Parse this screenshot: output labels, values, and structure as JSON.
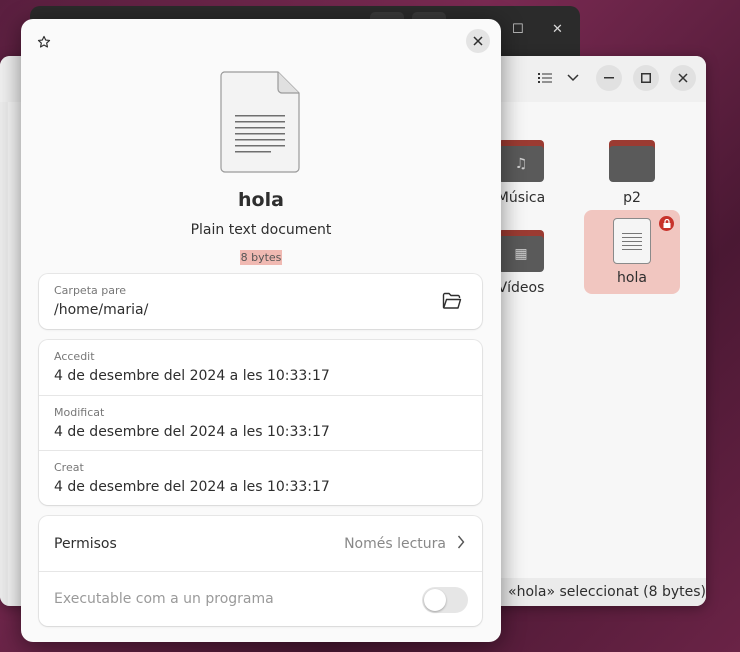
{
  "background": {
    "files": {
      "items": [
        {
          "label": "Música",
          "icon": "music-note-icon"
        },
        {
          "label": "p2",
          "icon": "folder-icon"
        },
        {
          "label": "Vídeos",
          "icon": "film-icon"
        },
        {
          "label": "hola",
          "icon": "text-file-icon"
        }
      ],
      "status": "«hola» seleccionat  (8 bytes)"
    }
  },
  "dialog": {
    "file_name": "hola",
    "file_type": "Plain text document",
    "file_size": "8 bytes",
    "parent": {
      "caption": "Carpeta pare",
      "value": "/home/maria/"
    },
    "times": [
      {
        "caption": "Accedit",
        "value": "4 de desembre del 2024 a les 10:33:17"
      },
      {
        "caption": "Modificat",
        "value": "4 de desembre del 2024 a les 10:33:17"
      },
      {
        "caption": "Creat",
        "value": "4 de desembre del 2024 a les 10:33:17"
      }
    ],
    "permissions": {
      "label": "Permisos",
      "value": "Només lectura"
    },
    "executable": {
      "label": "Executable com a un programa",
      "enabled": false
    }
  },
  "colors": {
    "selection": "#f1c6c0",
    "lock": "#c7322a",
    "size_highlight": "#f0b9b2"
  }
}
